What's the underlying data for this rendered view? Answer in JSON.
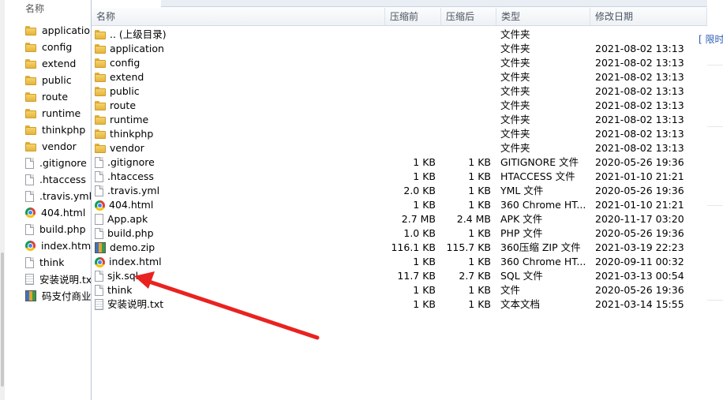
{
  "left_pane": {
    "header": "名称",
    "items": [
      {
        "label": "application",
        "icon": "folder-icon"
      },
      {
        "label": "config",
        "icon": "folder-icon"
      },
      {
        "label": "extend",
        "icon": "folder-icon"
      },
      {
        "label": "public",
        "icon": "folder-icon"
      },
      {
        "label": "route",
        "icon": "folder-icon"
      },
      {
        "label": "runtime",
        "icon": "folder-icon"
      },
      {
        "label": "thinkphp",
        "icon": "folder-icon"
      },
      {
        "label": "vendor",
        "icon": "folder-icon"
      },
      {
        "label": ".gitignore",
        "icon": "file-icon"
      },
      {
        "label": ".htaccess",
        "icon": "file-icon"
      },
      {
        "label": ".travis.yml",
        "icon": "file-icon"
      },
      {
        "label": "404.html",
        "icon": "chrome-icon"
      },
      {
        "label": "build.php",
        "icon": "file-icon"
      },
      {
        "label": "index.html",
        "icon": "chrome-icon"
      },
      {
        "label": "think",
        "icon": "file-icon"
      },
      {
        "label": "安装说明.tx",
        "icon": "text-file-icon"
      },
      {
        "label": "码支付商业",
        "icon": "zip-icon"
      }
    ]
  },
  "columns": {
    "name": "名称",
    "compressed": "压缩前",
    "original": "压缩后",
    "type": "类型",
    "modified": "修改日期"
  },
  "rows": [
    {
      "name": ".. (上级目录)",
      "icon": "folder-icon",
      "comp": "",
      "orig": "",
      "type": "文件夹",
      "date": ""
    },
    {
      "name": "application",
      "icon": "folder-icon",
      "comp": "",
      "orig": "",
      "type": "文件夹",
      "date": "2021-08-02 13:13"
    },
    {
      "name": "config",
      "icon": "folder-icon",
      "comp": "",
      "orig": "",
      "type": "文件夹",
      "date": "2021-08-02 13:13"
    },
    {
      "name": "extend",
      "icon": "folder-icon",
      "comp": "",
      "orig": "",
      "type": "文件夹",
      "date": "2021-08-02 13:13"
    },
    {
      "name": "public",
      "icon": "folder-icon",
      "comp": "",
      "orig": "",
      "type": "文件夹",
      "date": "2021-08-02 13:13"
    },
    {
      "name": "route",
      "icon": "folder-icon",
      "comp": "",
      "orig": "",
      "type": "文件夹",
      "date": "2021-08-02 13:13"
    },
    {
      "name": "runtime",
      "icon": "folder-icon",
      "comp": "",
      "orig": "",
      "type": "文件夹",
      "date": "2021-08-02 13:13"
    },
    {
      "name": "thinkphp",
      "icon": "folder-icon",
      "comp": "",
      "orig": "",
      "type": "文件夹",
      "date": "2021-08-02 13:13"
    },
    {
      "name": "vendor",
      "icon": "folder-icon",
      "comp": "",
      "orig": "",
      "type": "文件夹",
      "date": "2021-08-02 13:13"
    },
    {
      "name": ".gitignore",
      "icon": "file-icon",
      "comp": "1 KB",
      "orig": "1 KB",
      "type": "GITIGNORE 文件",
      "date": "2020-05-26 19:36"
    },
    {
      "name": ".htaccess",
      "icon": "file-icon",
      "comp": "1 KB",
      "orig": "1 KB",
      "type": "HTACCESS 文件",
      "date": "2021-01-10 21:21"
    },
    {
      "name": ".travis.yml",
      "icon": "file-icon",
      "comp": "2.0 KB",
      "orig": "1 KB",
      "type": "YML 文件",
      "date": "2020-05-26 19:36"
    },
    {
      "name": "404.html",
      "icon": "chrome-icon",
      "comp": "1 KB",
      "orig": "1 KB",
      "type": "360 Chrome HT...",
      "date": "2021-01-10 21:21"
    },
    {
      "name": "App.apk",
      "icon": "apk-file-icon",
      "comp": "2.7 MB",
      "orig": "2.4 MB",
      "type": "APK 文件",
      "date": "2020-11-17 03:20"
    },
    {
      "name": "build.php",
      "icon": "file-icon",
      "comp": "1.0 KB",
      "orig": "1 KB",
      "type": "PHP 文件",
      "date": "2020-05-26 19:36"
    },
    {
      "name": "demo.zip",
      "icon": "zip-icon",
      "comp": "116.1 KB",
      "orig": "115.7 KB",
      "type": "360压缩 ZIP 文件",
      "date": "2021-03-19 22:23"
    },
    {
      "name": "index.html",
      "icon": "chrome-icon",
      "comp": "1 KB",
      "orig": "1 KB",
      "type": "360 Chrome HT...",
      "date": "2020-09-11 00:32"
    },
    {
      "name": "sjk.sql",
      "icon": "file-icon",
      "comp": "11.7 KB",
      "orig": "2.7 KB",
      "type": "SQL 文件",
      "date": "2021-03-13 00:54"
    },
    {
      "name": "think",
      "icon": "file-icon",
      "comp": "1 KB",
      "orig": "1 KB",
      "type": "文件",
      "date": "2020-05-26 19:36"
    },
    {
      "name": "安装说明.txt",
      "icon": "text-file-icon",
      "comp": "1 KB",
      "orig": "1 KB",
      "type": "文本文档",
      "date": "2021-03-14 15:55"
    }
  ],
  "right_edge": {
    "text": "[ 限时"
  },
  "colors": {
    "annotation_arrow": "#e8231f",
    "folder": "#e6b43f",
    "link": "#2a5bb7"
  }
}
